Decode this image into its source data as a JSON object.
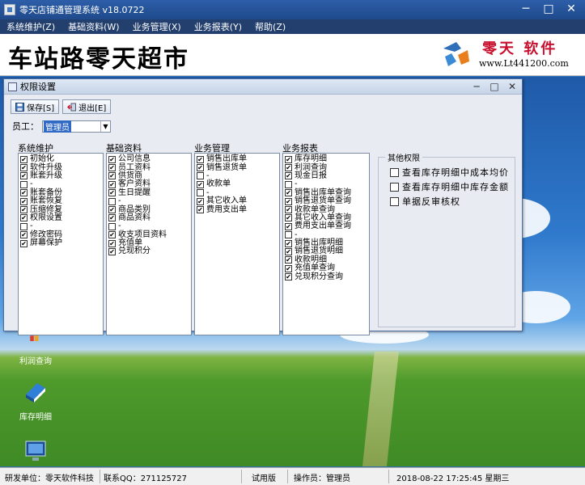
{
  "app": {
    "title": "零天店铺通管理系统   v18.0722",
    "window_buttons": {
      "minimize": "─",
      "maximize": "□",
      "close": "✕"
    }
  },
  "menu": [
    "系统维护(Z)",
    "基础资料(W)",
    "业务管理(X)",
    "业务报表(Y)",
    "帮助(Z)"
  ],
  "banner": {
    "store_name": "车站路零天超市",
    "logo_text": "零天 软件",
    "logo_url": "www.Lt441200.com"
  },
  "desktop_icons": [
    {
      "label": "利润查询",
      "icon": "chart-icon"
    },
    {
      "label": "库存明细",
      "icon": "book-icon"
    },
    {
      "label": "",
      "icon": "monitor-icon"
    }
  ],
  "perm_dialog": {
    "title": "权限设置",
    "buttons": {
      "save": "保存[S]",
      "exit": "退出[E]"
    },
    "employee_label": "员工：",
    "employee_value": "管理员",
    "columns": [
      {
        "title": "系统维护",
        "items": [
          {
            "label": "初始化",
            "checked": true
          },
          {
            "label": "软件升级",
            "checked": true
          },
          {
            "label": "账套升级",
            "checked": true
          },
          {
            "label": "-",
            "checked": false
          },
          {
            "label": "账套备份",
            "checked": true
          },
          {
            "label": "账套恢复",
            "checked": true
          },
          {
            "label": "压缩修复",
            "checked": true
          },
          {
            "label": "权限设置",
            "checked": true
          },
          {
            "label": "-",
            "checked": false
          },
          {
            "label": "修改密码",
            "checked": true
          },
          {
            "label": "屏幕保护",
            "checked": true
          }
        ]
      },
      {
        "title": "基础资料",
        "items": [
          {
            "label": "公司信息",
            "checked": true
          },
          {
            "label": "员工资料",
            "checked": true
          },
          {
            "label": "供货商",
            "checked": true
          },
          {
            "label": "客户资料",
            "checked": true
          },
          {
            "label": "生日提醒",
            "checked": true
          },
          {
            "label": "-",
            "checked": false
          },
          {
            "label": "商品类别",
            "checked": true
          },
          {
            "label": "商品资料",
            "checked": true
          },
          {
            "label": "-",
            "checked": false
          },
          {
            "label": "收支项目资料",
            "checked": true
          },
          {
            "label": "充值单",
            "checked": true
          },
          {
            "label": "兑现积分",
            "checked": true
          }
        ]
      },
      {
        "title": "业务管理",
        "items": [
          {
            "label": "销售出库单",
            "checked": true
          },
          {
            "label": "销售退货单",
            "checked": true
          },
          {
            "label": "-",
            "checked": false
          },
          {
            "label": "收款单",
            "checked": true
          },
          {
            "label": "-",
            "checked": false
          },
          {
            "label": "其它收入单",
            "checked": true
          },
          {
            "label": "费用支出单",
            "checked": true
          }
        ]
      },
      {
        "title": "业务报表",
        "items": [
          {
            "label": "库存明细",
            "checked": true
          },
          {
            "label": "利润查询",
            "checked": true
          },
          {
            "label": "现金日报",
            "checked": true
          },
          {
            "label": "-",
            "checked": false
          },
          {
            "label": "销售出库单查询",
            "checked": true
          },
          {
            "label": "销售退货单查询",
            "checked": true
          },
          {
            "label": "收款单查询",
            "checked": true
          },
          {
            "label": "其它收入单查询",
            "checked": true
          },
          {
            "label": "费用支出单查询",
            "checked": true
          },
          {
            "label": "-",
            "checked": false
          },
          {
            "label": "销售出库明细",
            "checked": true
          },
          {
            "label": "销售退货明细",
            "checked": true
          },
          {
            "label": "收款明细",
            "checked": true
          },
          {
            "label": "充值单查询",
            "checked": true
          },
          {
            "label": "兑现积分查询",
            "checked": true
          }
        ]
      }
    ],
    "other_group": {
      "title": "其他权限",
      "items": [
        {
          "label": "查看库存明细中成本均价",
          "checked": false
        },
        {
          "label": "查看库存明细中库存金额",
          "checked": false
        },
        {
          "label": "单据反审核权",
          "checked": false
        }
      ]
    }
  },
  "statusbar": {
    "dev": "研发单位：零天软件科技",
    "qq": "联系QQ：271125727",
    "edition": "试用版",
    "operator": "操作员：管理员",
    "datetime": "2018-08-22   17:25:45 星期三"
  },
  "colors": {
    "titlebar": "#2d5ea8",
    "menubar": "#233f6e",
    "logo_red": "#c8102e",
    "selection": "#316ac5"
  }
}
